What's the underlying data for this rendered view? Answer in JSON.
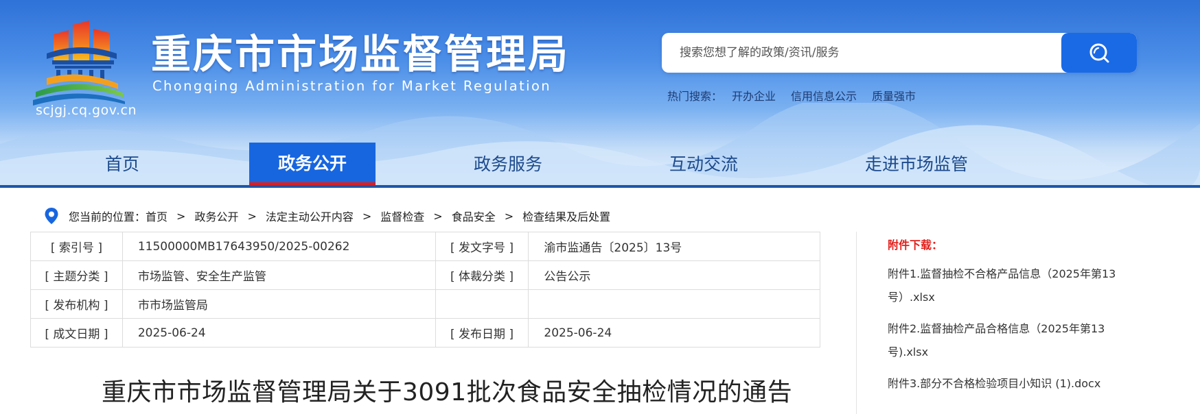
{
  "site": {
    "title_cn": "重庆市市场监督管理局",
    "title_en": "Chongqing  Administration for Market Regulation",
    "url": "scjgj.cq.gov.cn"
  },
  "search": {
    "placeholder": "搜索您想了解的政策/资讯/服务",
    "icon": "search-icon",
    "hot_label": "热门搜索：",
    "hot_links": [
      "开办企业",
      "信用信息公示",
      "质量强市"
    ]
  },
  "nav": {
    "items": [
      "首页",
      "政务公开",
      "政务服务",
      "互动交流",
      "走进市场监管"
    ],
    "active": "政务公开"
  },
  "breadcrumb": {
    "label": "您当前的位置：",
    "items": [
      "首页",
      "政务公开",
      "法定主动公开内容",
      "监督检查",
      "食品安全",
      "检查结果及后处置"
    ],
    "separator": ">"
  },
  "meta": {
    "index_label": "[ 索引号 ]",
    "index_value": "11500000MB17643950/2025-00262",
    "doc_no_label": "[ 发文字号 ]",
    "doc_no_value": "渝市监通告〔2025〕13号",
    "topic_label": "[ 主题分类 ]",
    "topic_value": "市场监管、安全生产监管",
    "genre_label": "[ 体裁分类 ]",
    "genre_value": "公告公示",
    "publisher_label": "[ 发布机构 ]",
    "publisher_value": "市市场监管局",
    "written_label": "[ 成文日期 ]",
    "written_value": "2025-06-24",
    "published_label": "[ 发布日期 ]",
    "published_value": "2025-06-24"
  },
  "document": {
    "title": "重庆市市场监督管理局关于3091批次食品安全抽检情况的通告"
  },
  "attachments": {
    "title": "附件下载：",
    "items": [
      "附件1.监督抽检不合格产品信息（2025年第13号）.xlsx",
      "附件2.监督抽检产品合格信息（2025年第13号).xlsx",
      "附件3.部分不合格检验项目小知识 (1).docx"
    ]
  },
  "colors": {
    "primary": "#1766e0",
    "nav_underline": "#e01c1c",
    "attachment_title": "#e0201c"
  }
}
